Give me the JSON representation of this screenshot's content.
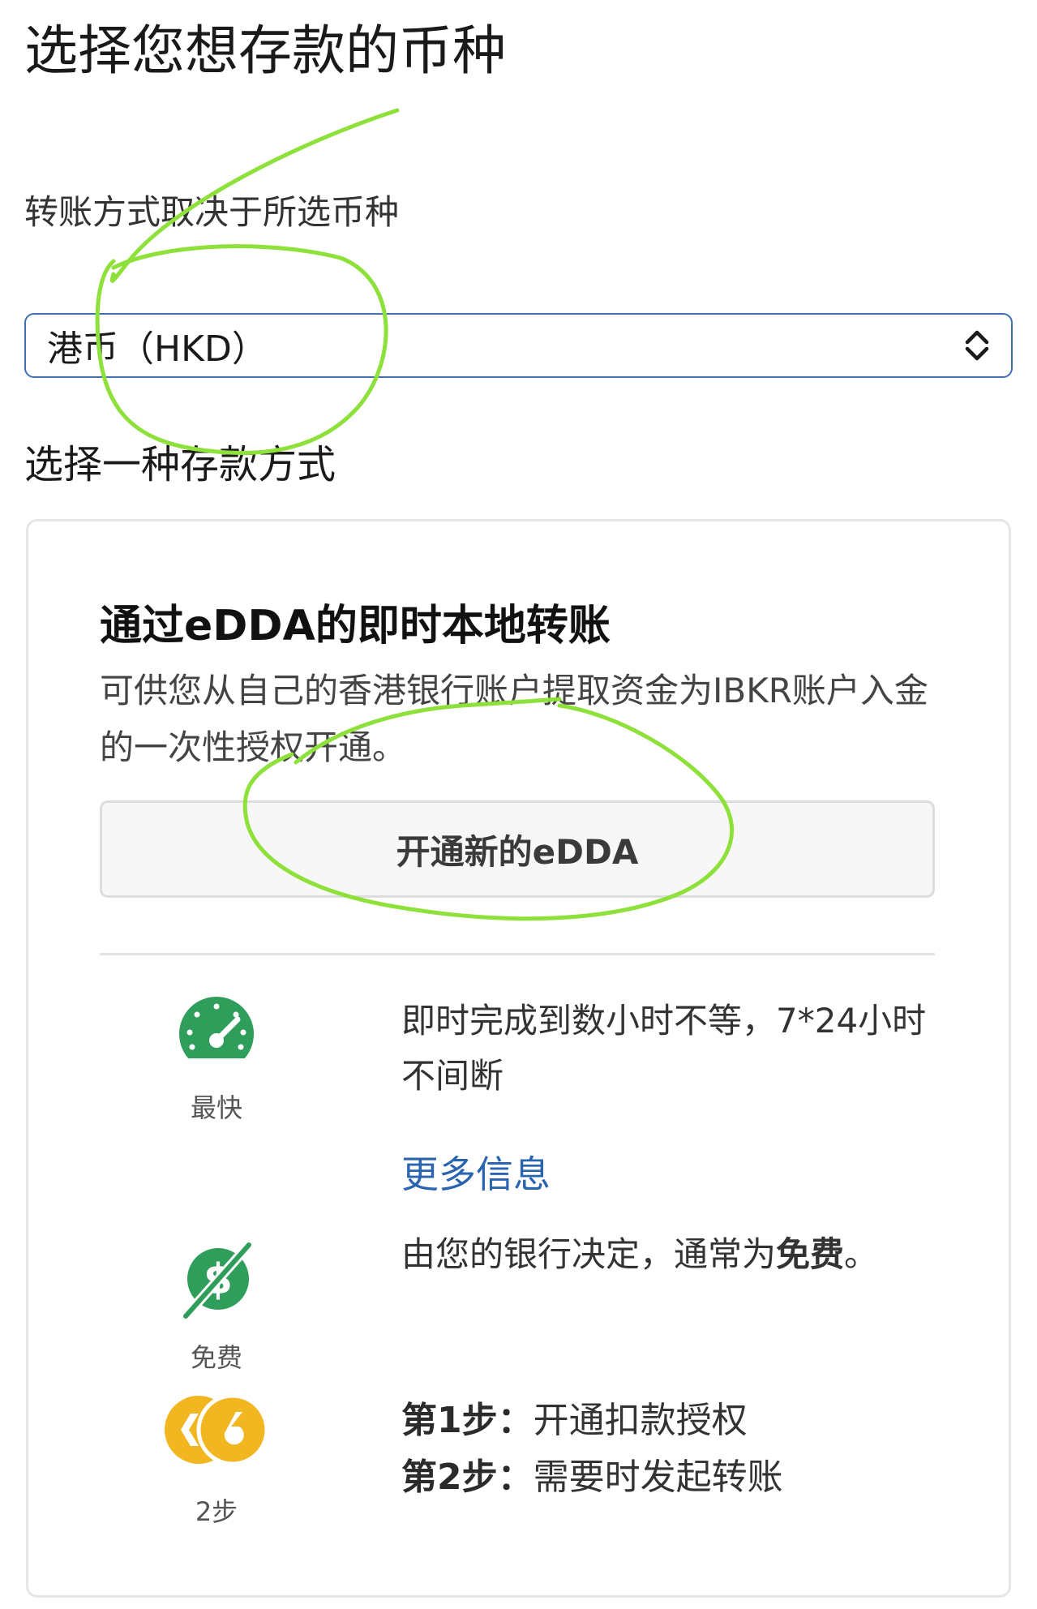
{
  "page": {
    "title": "选择您想存款的币种",
    "subtitle": "转账方式取决于所选币种"
  },
  "currency_select": {
    "selected": "港币（HKD）"
  },
  "section": {
    "label": "选择一种存款方式"
  },
  "card": {
    "title": "通过eDDA的即时本地转账",
    "description": "可供您从自己的香港银行账户提取资金为IBKR账户入金的一次性授权开通。",
    "button_label": "开通新的eDDA",
    "features": {
      "speed": {
        "caption": "最快",
        "text": "即时完成到数小时不等，7*24小时不间断",
        "link": "更多信息"
      },
      "fee": {
        "caption": "免费",
        "text_prefix": "由您的银行决定，通常为",
        "text_bold": "免费",
        "text_suffix": "。"
      },
      "steps": {
        "caption": "2步",
        "step1_label": "第1步：",
        "step1_text": "开通扣款授权",
        "step2_label": "第2步：",
        "step2_text": "需要时发起转账"
      }
    }
  },
  "colors": {
    "select_border": "#3f6fae",
    "link": "#2a63b0",
    "icon_green": "#2f9e5a",
    "icon_gold": "#f2b720",
    "annotation": "#8ee03a"
  },
  "icons": {
    "select": "sort-updown-icon",
    "speed": "speedometer-icon",
    "fee": "no-fee-dollar-icon",
    "steps": "two-steps-icon"
  }
}
